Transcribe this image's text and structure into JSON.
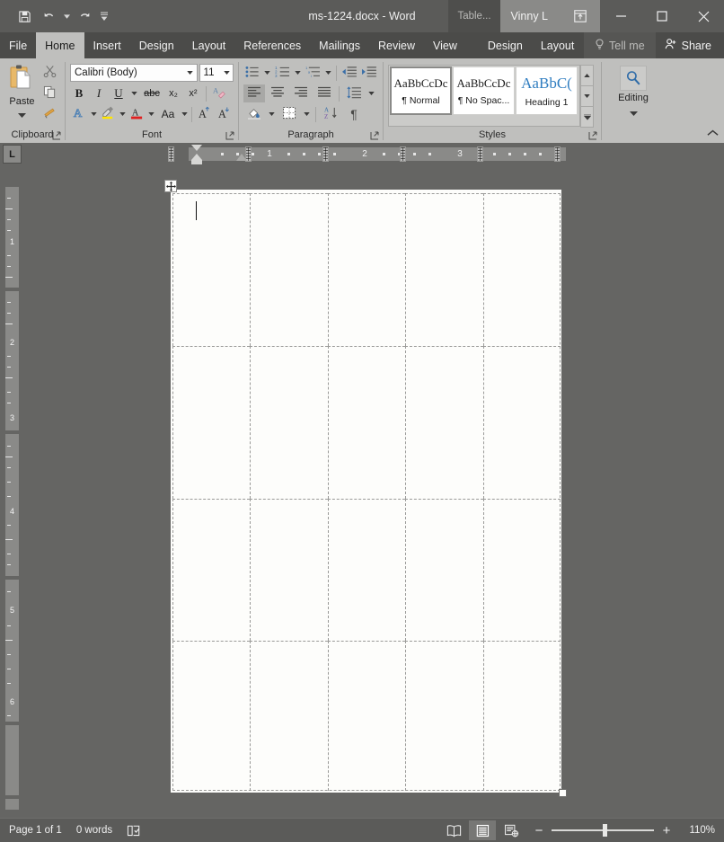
{
  "window": {
    "title": "ms-1224.docx - Word",
    "contextual_tools_label": "Table...",
    "account_name": "Vinny L",
    "quick_access": [
      {
        "name": "save",
        "icon": "save-icon"
      },
      {
        "name": "undo",
        "icon": "undo-icon"
      },
      {
        "name": "redo",
        "icon": "redo-icon"
      },
      {
        "name": "customize",
        "icon": "chevron-down-icon"
      }
    ],
    "controls": {
      "ribbon_display": "ribbon-display-options-icon",
      "minimize": "minimize-icon",
      "maximize": "maximize-icon",
      "close": "close-icon"
    }
  },
  "tabs": [
    {
      "label": "File",
      "active": false
    },
    {
      "label": "Home",
      "active": true
    },
    {
      "label": "Insert",
      "active": false
    },
    {
      "label": "Design",
      "active": false
    },
    {
      "label": "Layout",
      "active": false
    },
    {
      "label": "References",
      "active": false
    },
    {
      "label": "Mailings",
      "active": false
    },
    {
      "label": "Review",
      "active": false
    },
    {
      "label": "View",
      "active": false
    }
  ],
  "contextual_tabs": [
    {
      "label": "Design",
      "active": false
    },
    {
      "label": "Layout",
      "active": false
    }
  ],
  "tell_me": {
    "label": "Tell me",
    "icon": "lightbulb-icon"
  },
  "share": {
    "label": "Share",
    "icon": "person-share-icon"
  },
  "ribbon": {
    "groups": [
      {
        "label": "Clipboard"
      },
      {
        "label": "Font"
      },
      {
        "label": "Paragraph"
      },
      {
        "label": "Styles"
      }
    ],
    "clipboard": {
      "paste_label": "Paste",
      "cut": "scissors-icon",
      "copy": "copy-icon",
      "format_painter": "format-painter-icon"
    },
    "font": {
      "font_name": "Calibri (Body)",
      "font_size": "11",
      "bold": "B",
      "italic": "I",
      "underline": "U",
      "strikethrough": "abc",
      "subscript": "x₂",
      "superscript": "x²",
      "clear_formatting": "clear-formatting-icon",
      "text_effects": "A",
      "highlight": "highlight-icon",
      "font_color": "A",
      "change_case": "Aa",
      "grow_font": "A",
      "shrink_font": "A"
    },
    "paragraph": {
      "bullets": "bullets-icon",
      "numbering": "numbering-icon",
      "multilevel": "multilevel-list-icon",
      "decrease_indent": "decrease-indent-icon",
      "increase_indent": "increase-indent-icon",
      "align_left": "align-left-icon",
      "align_center": "align-center-icon",
      "align_right": "align-right-icon",
      "justify": "justify-icon",
      "line_spacing": "line-spacing-icon",
      "shading": "shading-icon",
      "borders": "borders-icon",
      "sort": "sort-icon",
      "show_marks": "¶"
    },
    "styles": [
      {
        "sample": "AaBbCcDc",
        "name": "¶ Normal",
        "active": true,
        "heading": false
      },
      {
        "sample": "AaBbCcDc",
        "name": "¶ No Spac...",
        "active": false,
        "heading": false
      },
      {
        "sample": "AaBbC(",
        "name": "Heading 1",
        "active": false,
        "heading": true
      }
    ],
    "editing": {
      "label": "Editing",
      "icon": "magnifier-icon"
    },
    "collapse": "collapse-ribbon-icon"
  },
  "ruler": {
    "tab_selector": "L",
    "horizontal_numbers": [
      "1",
      "2",
      "3"
    ],
    "vertical_numbers": [
      "1",
      "2",
      "3",
      "4",
      "5",
      "6"
    ]
  },
  "document": {
    "table": {
      "columns": 5,
      "rows": 4,
      "move_handle": "table-move-handle-icon",
      "resize_handle": "table-resize-handle-icon",
      "cells": [
        [
          "",
          "",
          "",
          "",
          ""
        ],
        [
          "",
          "",
          "",
          "",
          ""
        ],
        [
          "",
          "",
          "",
          "",
          ""
        ],
        [
          "",
          "",
          "",
          "",
          ""
        ]
      ]
    }
  },
  "status_bar": {
    "page": "Page 1 of 1",
    "words": "0 words",
    "proofing": "proofing-icon",
    "views": [
      {
        "name": "read-mode",
        "icon": "read-mode-icon",
        "selected": false
      },
      {
        "name": "print-layout",
        "icon": "print-layout-icon",
        "selected": true
      },
      {
        "name": "web-layout",
        "icon": "web-layout-icon",
        "selected": false
      }
    ],
    "zoom_out": "−",
    "zoom_in": "+",
    "zoom_level": "110%"
  },
  "colors": {
    "chrome": "#5b5b59",
    "ribbon": "#bfbfbd",
    "canvas": "#656563",
    "page": "#fdfdfb",
    "accent": "#2f7dc0"
  }
}
